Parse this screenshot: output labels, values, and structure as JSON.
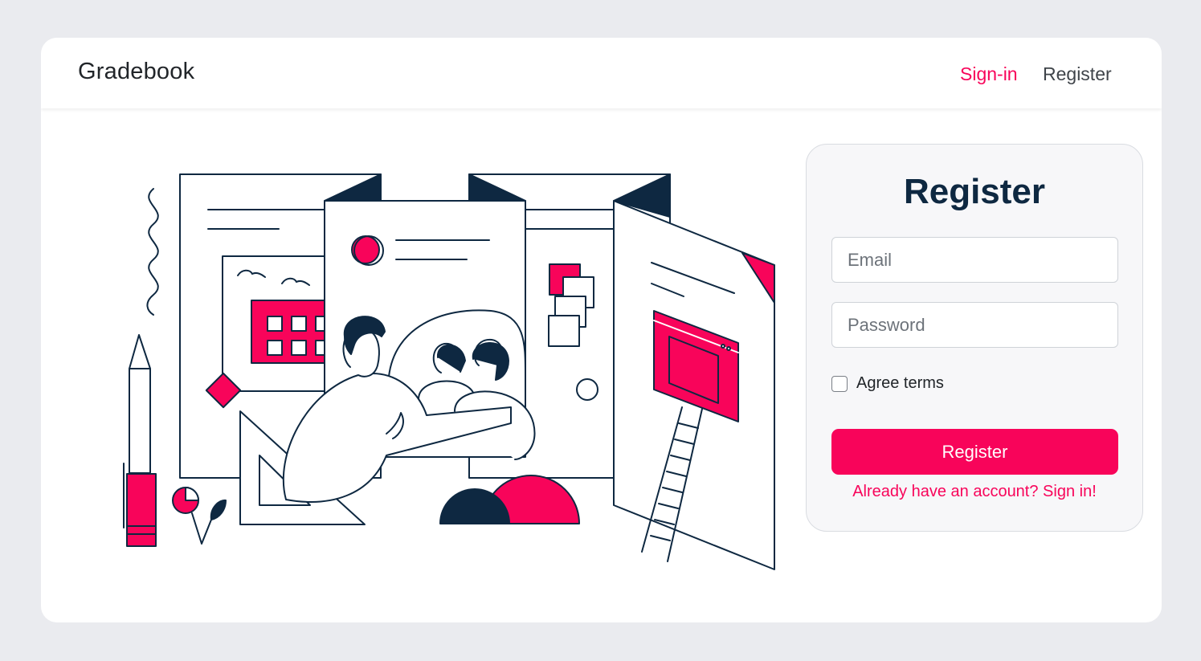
{
  "app": {
    "brand": "Gradebook"
  },
  "nav": {
    "signin_label": "Sign-in",
    "register_label": "Register"
  },
  "form": {
    "title": "Register",
    "email_placeholder": "Email",
    "password_placeholder": "Password",
    "agree_label": "Agree terms",
    "agree_checked": false,
    "submit_label": "Register",
    "signin_link": "Already have an account? Sign in!"
  },
  "colors": {
    "accent": "#f8045a",
    "navy": "#0e2841",
    "background": "#eaebef",
    "panel": "#f7f7f9"
  },
  "illustration": {
    "icon": "classroom-illustration"
  }
}
